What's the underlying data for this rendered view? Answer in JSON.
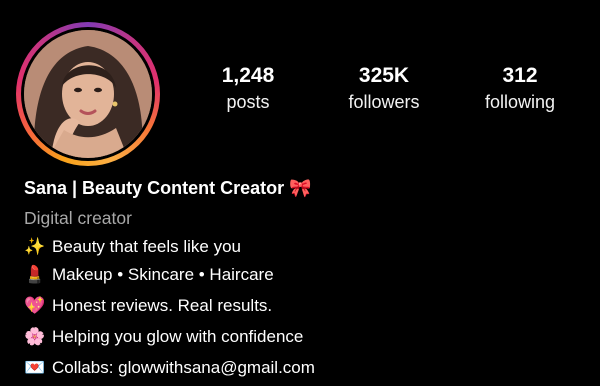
{
  "profile": {
    "stats": [
      {
        "value": "1,248",
        "label": "posts"
      },
      {
        "value": "325K",
        "label": "followers"
      },
      {
        "value": "312",
        "label": "following"
      }
    ],
    "name": "Sana | Beauty Content Creator 🎀",
    "category": "Digital creator",
    "bio_lines": [
      {
        "icon": "✨",
        "text": "Beauty that feels like you"
      },
      {
        "icon": "💄",
        "text": "Makeup • Skincare • Haircare"
      },
      {
        "icon": "💖",
        "text": "Honest reviews. Real results."
      },
      {
        "icon": "🌸",
        "text": "Helping you glow with confidence"
      },
      {
        "icon": "💌",
        "text": "Collabs: glowwithsana@gmail.com"
      }
    ]
  },
  "colors": {
    "background": "#000000",
    "text": "#ffffff",
    "secondary_text": "#a8a8a8",
    "story_ring": [
      "#f9a21b",
      "#e1306c",
      "#833ab4"
    ]
  }
}
